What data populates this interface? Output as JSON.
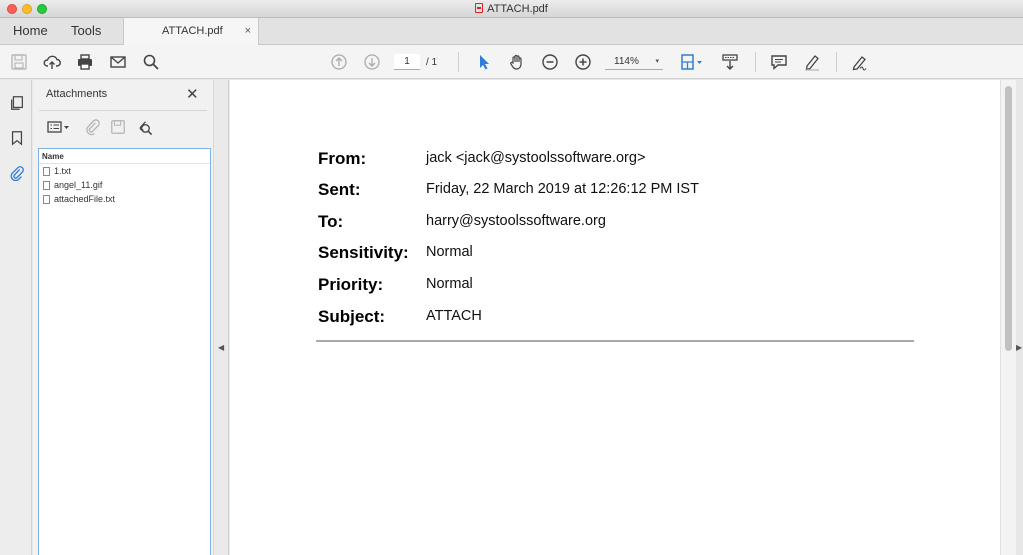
{
  "window": {
    "title": "ATTACH.pdf"
  },
  "tabs": {
    "home": "Home",
    "tools": "Tools",
    "document": "ATTACH.pdf",
    "close": "×"
  },
  "toolbar": {
    "page_current": "1",
    "page_total": "/ 1",
    "zoom": "114%",
    "zoom_caret": "▾"
  },
  "attachments": {
    "title": "Attachments",
    "close": "✕",
    "column_header": "Name",
    "files": [
      {
        "name": "1.txt",
        "icon": "text-file-icon"
      },
      {
        "name": "angel_11.gif",
        "icon": "image-file-icon"
      },
      {
        "name": "attachedFile.txt",
        "icon": "text-file-icon"
      }
    ]
  },
  "email": {
    "from_label": "From:",
    "from_value": "jack <jack@systoolssoftware.org>",
    "sent_label": "Sent:",
    "sent_value": "Friday, 22 March 2019 at 12:26:12 PM IST",
    "to_label": "To:",
    "to_value": "harry@systoolssoftware.org",
    "sensitivity_label": "Sensitivity:",
    "sensitivity_value": "Normal",
    "priority_label": "Priority:",
    "priority_value": "Normal",
    "subject_label": "Subject:",
    "subject_value": "ATTACH"
  },
  "colors": {
    "accent": "#2f7fd4",
    "panel_border": "#7fb2e5"
  }
}
